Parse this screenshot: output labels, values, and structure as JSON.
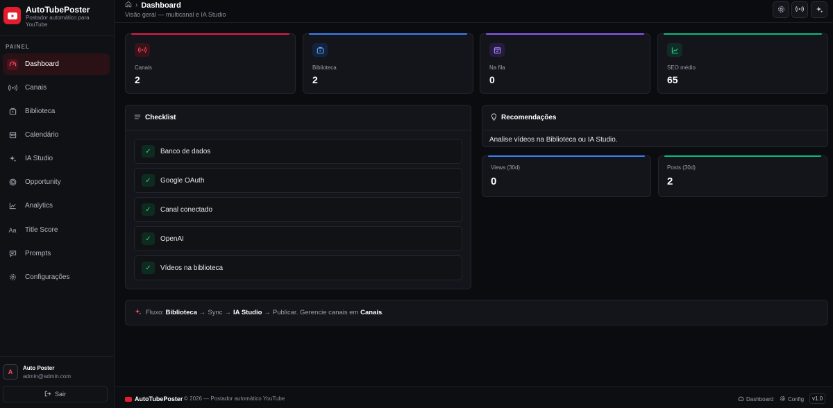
{
  "brand": {
    "name": "AutoTubePoster",
    "subtitle": "Postador automático para YouTube"
  },
  "sidebar": {
    "section_label": "PAINEL",
    "items": [
      {
        "label": "Dashboard",
        "icon": "gauge-icon",
        "active": true
      },
      {
        "label": "Canais",
        "icon": "broadcast-icon"
      },
      {
        "label": "Biblioteca",
        "icon": "library-icon"
      },
      {
        "label": "Calendário",
        "icon": "calendar-icon"
      },
      {
        "label": "IA Studio",
        "icon": "sparkles-icon"
      },
      {
        "label": "Opportunity",
        "icon": "target-icon"
      },
      {
        "label": "Analytics",
        "icon": "chart-line-icon"
      },
      {
        "label": "Title Score",
        "icon": "text-aa-icon"
      },
      {
        "label": "Prompts",
        "icon": "message-icon"
      },
      {
        "label": "Configurações",
        "icon": "gear-icon"
      }
    ]
  },
  "user": {
    "initial": "A",
    "name": "Auto Poster",
    "email": "admin@admin.com",
    "logout_label": "Sair"
  },
  "header": {
    "title": "Dashboard",
    "subtitle": "Visão geral — multicanal e IA Studio"
  },
  "stats": [
    {
      "label": "Canais",
      "value": "2",
      "accent": "#e11d48"
    },
    {
      "label": "Biblioteca",
      "value": "2",
      "accent": "#3b82f6"
    },
    {
      "label": "Na fila",
      "value": "0",
      "accent": "#8b5cf6"
    },
    {
      "label": "SEO médio",
      "value": "65",
      "accent": "#10b981"
    }
  ],
  "checklist": {
    "title": "Checklist",
    "items": [
      {
        "label": "Banco de dados"
      },
      {
        "label": "Google OAuth"
      },
      {
        "label": "Canal conectado"
      },
      {
        "label": "OpenAI"
      },
      {
        "label": "Vídeos na biblioteca"
      }
    ]
  },
  "recommendations": {
    "title": "Recomendações",
    "text": "Analise vídeos na Biblioteca ou IA Studio."
  },
  "mini_stats": [
    {
      "label": "Views (30d)",
      "value": "0",
      "accent": "#3b82f6"
    },
    {
      "label": "Posts (30d)",
      "value": "2",
      "accent": "#10b981"
    }
  ],
  "flow": {
    "prefix": "Fluxo:",
    "step1": "Biblioteca",
    "step2": "Sync",
    "step3": "IA Studio",
    "step4": "Publicar.",
    "suffix": "Gerencie canais em",
    "link": "Canais",
    "end": ".",
    "arrow": "→"
  },
  "footer": {
    "brand": "AutoTubePoster",
    "copyright": "© 2026 — Postador automático YouTube",
    "link_dashboard": "Dashboard",
    "link_config": "Config",
    "version": "v1.0"
  }
}
